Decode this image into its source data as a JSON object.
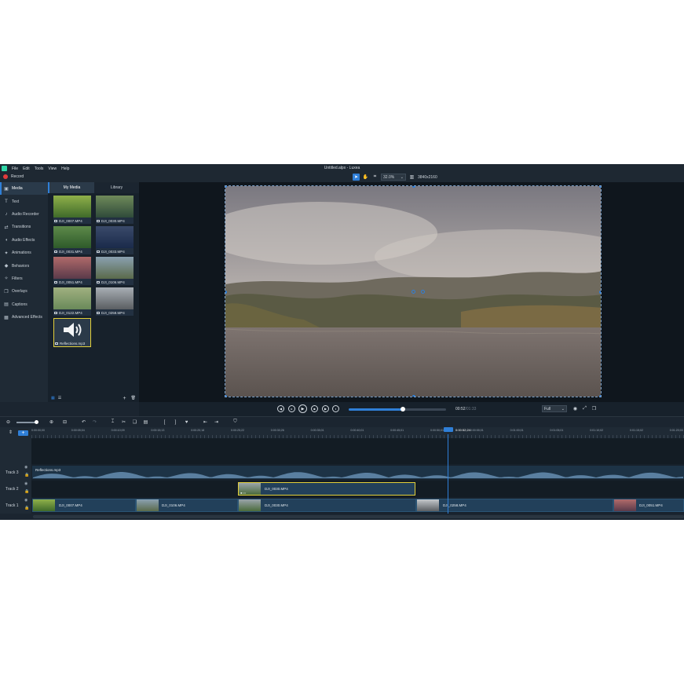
{
  "menu": {
    "items": [
      "File",
      "Edit",
      "Tools",
      "View",
      "Help"
    ],
    "window_title": "Untitled.alpx - Luxea"
  },
  "recordbar": {
    "record_label": "Record",
    "zoom_value": "32.0%",
    "resolution": "3840x2160"
  },
  "sidebar": {
    "items": [
      {
        "label": "Media",
        "icon": "media-icon",
        "glyph": "▣"
      },
      {
        "label": "Text",
        "icon": "text-icon",
        "glyph": "T"
      },
      {
        "label": "Audio Recorder",
        "icon": "mic-icon",
        "glyph": "♪"
      },
      {
        "label": "Transitions",
        "icon": "transitions-icon",
        "glyph": "⇄"
      },
      {
        "label": "Audio Effects",
        "icon": "speaker-icon",
        "glyph": "◖"
      },
      {
        "label": "Animations",
        "icon": "wand-icon",
        "glyph": "✦"
      },
      {
        "label": "Behaviors",
        "icon": "behaviors-icon",
        "glyph": "◆"
      },
      {
        "label": "Filters",
        "icon": "filters-icon",
        "glyph": "✧"
      },
      {
        "label": "Overlays",
        "icon": "overlays-icon",
        "glyph": "❐"
      },
      {
        "label": "Captions",
        "icon": "captions-icon",
        "glyph": "▤"
      },
      {
        "label": "Advanced Effects",
        "icon": "effects-icon",
        "glyph": "▦"
      }
    ]
  },
  "media": {
    "tabs": [
      "My Media",
      "Library"
    ],
    "items": [
      {
        "name": "DJI_0007.MP4",
        "kind": "video",
        "colors": [
          "#8fb04a",
          "#3f6a2a"
        ]
      },
      {
        "name": "DJI_0030.MP4",
        "kind": "video",
        "colors": [
          "#6f8a5a",
          "#2f4a3a"
        ]
      },
      {
        "name": "DJI_0031.MP4",
        "kind": "video",
        "colors": [
          "#5e8a4a",
          "#2e5a2a"
        ]
      },
      {
        "name": "DJI_0033.MP4",
        "kind": "video",
        "colors": [
          "#3a4a6a",
          "#1a2a4a"
        ]
      },
      {
        "name": "DJI_0051.MP4",
        "kind": "video",
        "colors": [
          "#b06a6a",
          "#5a3a4a"
        ]
      },
      {
        "name": "DJI_0106.MP4",
        "kind": "video",
        "colors": [
          "#8aa0b0",
          "#5a6a4a"
        ]
      },
      {
        "name": "DJI_0122.MP4",
        "kind": "video",
        "colors": [
          "#a0b080",
          "#6a8a5a"
        ]
      },
      {
        "name": "DJI_0258.MP4",
        "kind": "video",
        "colors": [
          "#a8aeb4",
          "#5a5e62"
        ]
      },
      {
        "name": "Reflections.mp3",
        "kind": "audio"
      }
    ]
  },
  "playback": {
    "time_current": "00:52",
    "time_total": "/01:33",
    "progress": 0.56,
    "quality": "Full"
  },
  "ruler": {
    "ticks": [
      "0:00:00;00",
      "0:00:05;04",
      "0:00:10;09",
      "0:00:15;13",
      "0:00:20;18",
      "0:00:25;22",
      "0:00:30;26",
      "0:00:35;01",
      "0:00:40;01",
      "0:00:45;01",
      "0:00:50;01",
      "0:00:55;01",
      "0:01:00;01",
      "0:01:05;01",
      "0:01:10;02",
      "0:01:15;02",
      "0:01:20;03"
    ],
    "playhead_time": "0:00:52;24"
  },
  "tracks": [
    {
      "label": "Track 3",
      "clips": [
        {
          "name": "Reflections.mp3",
          "type": "audio"
        }
      ]
    },
    {
      "label": "Track 2",
      "clips": [
        {
          "name": "DJI_0030.MP4",
          "type": "video",
          "selected": true
        }
      ]
    },
    {
      "label": "Track 1",
      "clips": [
        {
          "name": "DJI_0007.MP4",
          "type": "video"
        },
        {
          "name": "DJI_0106.MP4",
          "type": "video"
        },
        {
          "name": "DJI_0030.MP4",
          "type": "video"
        },
        {
          "name": "DJI_0258.MP4",
          "type": "video"
        },
        {
          "name": "DJI_0051.MP4",
          "type": "video"
        }
      ]
    }
  ],
  "colors": {
    "accent": "#2f7fd8",
    "selection": "#e2cf3a",
    "record": "#e23b3b",
    "app_bg": "#1b2530"
  }
}
